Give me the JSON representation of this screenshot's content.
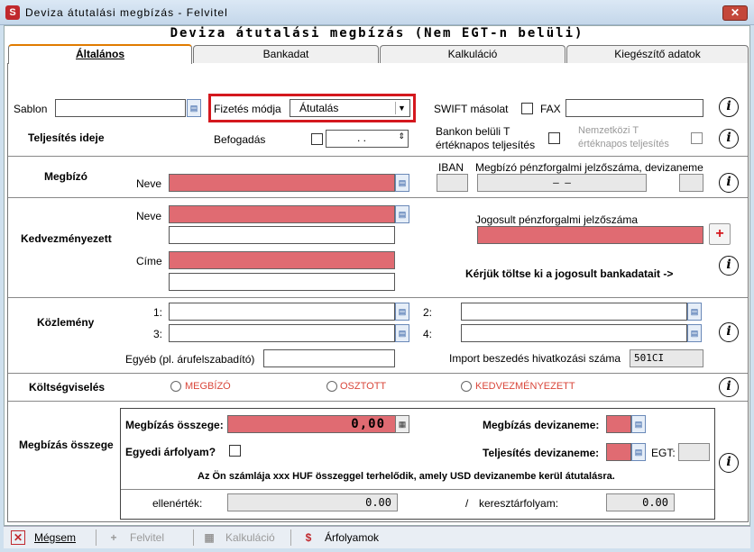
{
  "window": {
    "title": "Deviza átutalási megbízás - Felvitel",
    "logo": "S"
  },
  "heading": "Deviza átutalási megbízás (Nem EGT-n belüli)",
  "tabs": [
    {
      "label": "Általános"
    },
    {
      "label": "Bankadat"
    },
    {
      "label": "Kalkuláció"
    },
    {
      "label": "Kiegészítő adatok"
    }
  ],
  "row1": {
    "sablon_label": "Sablon",
    "fizetes_mod_label": "Fizetés módja",
    "fizetes_mod_value": "Átutalás",
    "swift_label": "SWIFT másolat",
    "fax_label": "FAX"
  },
  "teljesites": {
    "label": "Teljesítés ideje",
    "befogadas_label": "Befogadás",
    "date_value": ". .",
    "bankon_beluli_line1": "Bankon belüli T",
    "bankon_beluli_line2": "értéknapos teljesítés",
    "nemzetkozi_line1": "Nemzetközi T",
    "nemzetkozi_line2": "értéknapos teljesítés"
  },
  "megbizo": {
    "label": "Megbízó",
    "neve_label": "Neve",
    "iban_label": "IBAN",
    "szamla_label": "Megbízó pénzforgalmi jelzőszáma, devizaneme",
    "szamla_value": "–          –"
  },
  "kedvezmenyezett": {
    "label": "Kedvezményezett",
    "neve_label": "Neve",
    "cime_label": "Címe",
    "jogosult_label": "Jogosult pénzforgalmi jelzőszáma",
    "kerjuk": "Kérjük töltse ki a jogosult bankadatait ->"
  },
  "kozlemeny": {
    "label": "Közlemény",
    "n1": "1:",
    "n2": "2:",
    "n3": "3:",
    "n4": "4:",
    "egyeb_label": "Egyéb (pl. árufelszabadító)",
    "import_label": "Import beszedés hivatkozási száma",
    "import_value": "501CI"
  },
  "koltseg": {
    "label": "Költségviselés",
    "options": [
      "MEGBÍZÓ",
      "OSZTOTT",
      "KEDVEZMÉNYEZETT"
    ]
  },
  "osszeg": {
    "label": "Megbízás összege",
    "osszeg_label": "Megbízás összege:",
    "osszeg_value": "0,00",
    "egyedi_label": "Egyedi árfolyam?",
    "devizanem_label": "Megbízás devizaneme:",
    "telj_devizanem_label": "Teljesítés devizaneme:",
    "egt_label": "EGT:",
    "info_text": "Az Ön számlája xxx HUF összeggel terhelődik, amely USD devizanembe kerül átutalásra.",
    "ellenertek_label": "ellenérték:",
    "ellenertek_value": "0.00",
    "slash": "/",
    "kereszt_label": "keresztárfolyam:",
    "kereszt_value": "0.00"
  },
  "toolbar": {
    "megsem": "Mégsem",
    "felvitel": "Felvitel",
    "kalkulacio": "Kalkuláció",
    "arfolyamok": "Árfolyamok"
  },
  "colors": {
    "required": "#e06b72",
    "highlight_border": "#d4181e",
    "tab_accent": "#e07b00"
  }
}
